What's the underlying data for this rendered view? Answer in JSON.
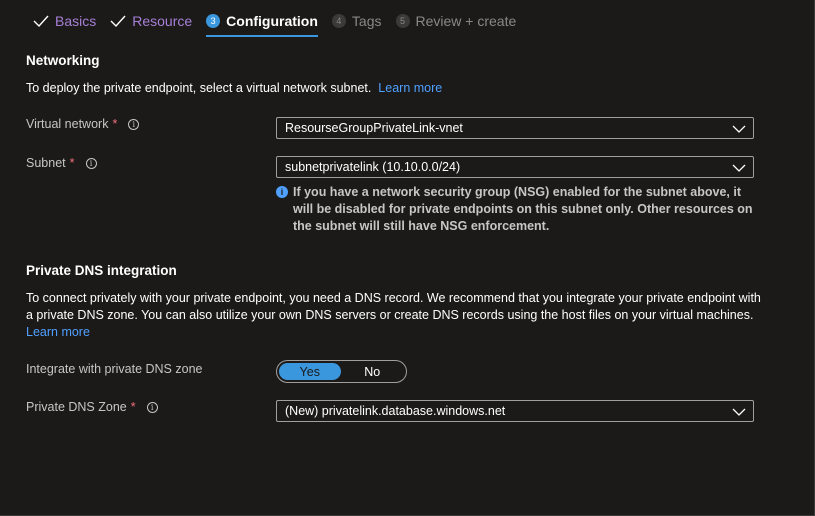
{
  "tabs": [
    {
      "label": "Basics",
      "state": "done"
    },
    {
      "label": "Resource",
      "state": "done"
    },
    {
      "label": "Configuration",
      "state": "active",
      "number": "3"
    },
    {
      "label": "Tags",
      "state": "pending",
      "number": "4"
    },
    {
      "label": "Review + create",
      "state": "pending",
      "number": "5"
    }
  ],
  "networking": {
    "title": "Networking",
    "description": "To deploy the private endpoint, select a virtual network subnet.",
    "learn_more": "Learn more",
    "virtual_network": {
      "label": "Virtual network",
      "required": "*",
      "value": "ResourseGroupPrivateLink-vnet"
    },
    "subnet": {
      "label": "Subnet",
      "required": "*",
      "value": "subnetprivatelink (10.10.0.0/24)"
    },
    "note": "If you have a network security group (NSG) enabled for the subnet above, it will be disabled for private endpoints on this subnet only. Other resources on the subnet will still have NSG enforcement."
  },
  "dns": {
    "title": "Private DNS integration",
    "description": "To connect privately with your private endpoint, you need a DNS record. We recommend that you integrate your private endpoint with a private DNS zone. You can also utilize your own DNS servers or create DNS records using the host files on your virtual machines.",
    "learn_more": "Learn more",
    "integrate": {
      "label": "Integrate with private DNS zone",
      "yes": "Yes",
      "no": "No",
      "selected": "Yes"
    },
    "zone": {
      "label": "Private DNS Zone",
      "required": "*",
      "value": "(New) privatelink.database.windows.net"
    }
  },
  "colors": {
    "accent": "#3a96dd",
    "link": "#4fa0ff",
    "done_tab": "#a77fd6",
    "required": "#f1707b"
  }
}
